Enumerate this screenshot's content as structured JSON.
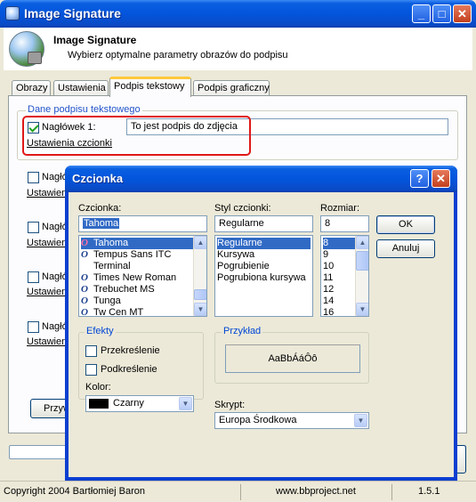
{
  "main_window": {
    "title": "Image Signature",
    "header_title": "Image Signature",
    "header_subtitle": "Wybierz optymalne parametry obrazów do podpisu",
    "tabs": [
      "Obrazy",
      "Ustawienia",
      "Podpis tekstowy",
      "Podpis graficzny"
    ],
    "active_tab": "Podpis tekstowy",
    "group_label": "Dane podpisu tekstowego",
    "headline_1_label": "Nagłówek 1:",
    "headline_1_value": "To jest podpis do zdjęcia",
    "font_settings_link": "Ustawienia czcionki",
    "hidden_label_prefix": "Nagłó",
    "hidden_link_prefix": "Ustawien",
    "hidden_button_prefix": "Przyw"
  },
  "status_bar": {
    "copyright": "Copyright 2004 Bartłomiej Baron",
    "website": "www.bbproject.net",
    "version": "1.5.1"
  },
  "font_dialog": {
    "title": "Czcionka",
    "font_label": "Czcionka:",
    "font_value": "Tahoma",
    "fonts": [
      "Tahoma",
      "Tempus Sans ITC",
      "Terminal",
      "Times New Roman",
      "Trebuchet MS",
      "Tunga",
      "Tw Cen MT"
    ],
    "style_label": "Styl czcionki:",
    "style_value": "Regularne",
    "styles": [
      "Regularne",
      "Kursywa",
      "Pogrubienie",
      "Pogrubiona kursywa"
    ],
    "size_label": "Rozmiar:",
    "size_value": "8",
    "sizes": [
      "8",
      "9",
      "10",
      "11",
      "12",
      "14",
      "16"
    ],
    "ok_label": "OK",
    "cancel_label": "Anuluj",
    "effects_label": "Efekty",
    "strikeout_label": "Przekreślenie",
    "underline_label": "Podkreślenie",
    "color_label": "Kolor:",
    "color_value": "Czarny",
    "sample_label": "Przykład",
    "sample_text": "AaBbÁáÔô",
    "script_label": "Skrypt:",
    "script_value": "Europa Środkowa"
  },
  "colors": {
    "titlebar": "#0355dc",
    "selection": "#316ac5",
    "highlight_outline": "#e01818",
    "window_bg": "#ece9d8"
  }
}
